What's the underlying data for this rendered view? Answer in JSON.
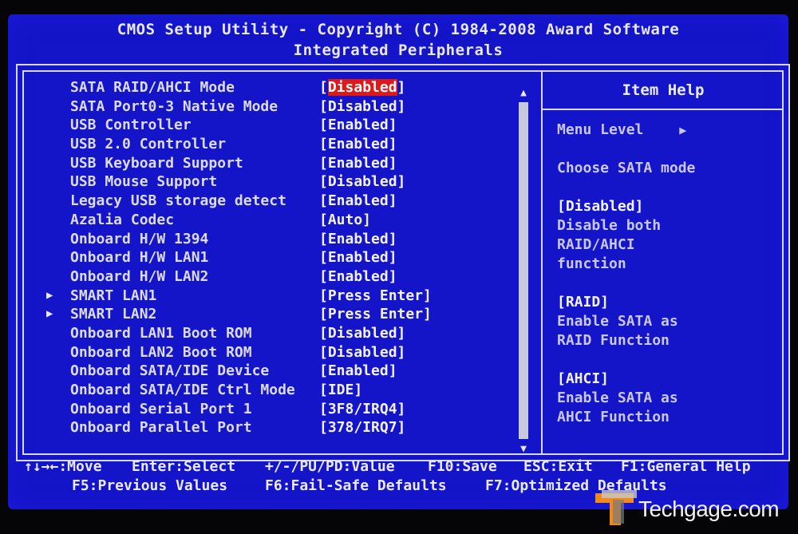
{
  "header": {
    "title": "CMOS Setup Utility - Copyright (C) 1984-2008 Award Software",
    "subtitle": "Integrated Peripherals"
  },
  "settings": [
    {
      "label": "SATA RAID/AHCI Mode",
      "value": "[Disabled]",
      "value_inner": "Disabled",
      "selected": true,
      "submenu": false
    },
    {
      "label": "SATA Port0-3 Native Mode",
      "value": "[Disabled]",
      "submenu": false
    },
    {
      "label": "USB Controller",
      "value": "[Enabled]",
      "submenu": false
    },
    {
      "label": "USB 2.0 Controller",
      "value": "[Enabled]",
      "submenu": false
    },
    {
      "label": "USB Keyboard Support",
      "value": "[Enabled]",
      "submenu": false
    },
    {
      "label": "USB Mouse Support",
      "value": "[Disabled]",
      "submenu": false
    },
    {
      "label": "Legacy USB storage detect",
      "value": "[Enabled]",
      "submenu": false
    },
    {
      "label": "Azalia Codec",
      "value": "[Auto]",
      "submenu": false
    },
    {
      "label": "Onboard H/W 1394",
      "value": "[Enabled]",
      "submenu": false
    },
    {
      "label": "Onboard H/W LAN1",
      "value": "[Enabled]",
      "submenu": false
    },
    {
      "label": "Onboard H/W LAN2",
      "value": "[Enabled]",
      "submenu": false
    },
    {
      "label": "SMART LAN1",
      "value": "[Press Enter]",
      "submenu": true
    },
    {
      "label": "SMART LAN2",
      "value": "[Press Enter]",
      "submenu": true
    },
    {
      "label": "Onboard LAN1 Boot ROM",
      "value": "[Disabled]",
      "submenu": false
    },
    {
      "label": "Onboard LAN2 Boot ROM",
      "value": "[Disabled]",
      "submenu": false
    },
    {
      "label": "Onboard SATA/IDE Device",
      "value": "[Enabled]",
      "submenu": false
    },
    {
      "label": "Onboard SATA/IDE Ctrl Mode",
      "value": "[IDE]",
      "submenu": false
    },
    {
      "label": "Onboard Serial Port 1",
      "value": "[3F8/IRQ4]",
      "submenu": false
    },
    {
      "label": "Onboard Parallel Port",
      "value": "[378/IRQ7]",
      "submenu": false
    }
  ],
  "help": {
    "title": "Item Help",
    "menu_level": "Menu Level",
    "menu_level_arrow": "▶",
    "description": "Choose SATA mode",
    "options": [
      {
        "name": "[Disabled]",
        "lines": [
          "Disable both",
          "RAID/AHCI",
          "function"
        ]
      },
      {
        "name": "[RAID]",
        "lines": [
          "Enable SATA as",
          "RAID Function"
        ]
      },
      {
        "name": "[AHCI]",
        "lines": [
          "Enable SATA as",
          "AHCI Function"
        ]
      }
    ]
  },
  "footer": {
    "line1": [
      "↑↓→←:Move",
      "Enter:Select",
      "+/-/PU/PD:Value",
      "F10:Save",
      "ESC:Exit",
      "F1:General Help"
    ],
    "line2": [
      "F5:Previous Values",
      "F6:Fail-Safe Defaults",
      "F7:Optimized Defaults"
    ]
  },
  "watermark": {
    "text": "Techgage.com"
  },
  "colors": {
    "background": "#1414c8",
    "highlight": "#e01818",
    "text": "#dcdcf0"
  },
  "icons": {
    "submenu": "triangle-right-icon",
    "scroll_up": "triangle-up-icon",
    "scroll_down": "triangle-down-icon"
  }
}
